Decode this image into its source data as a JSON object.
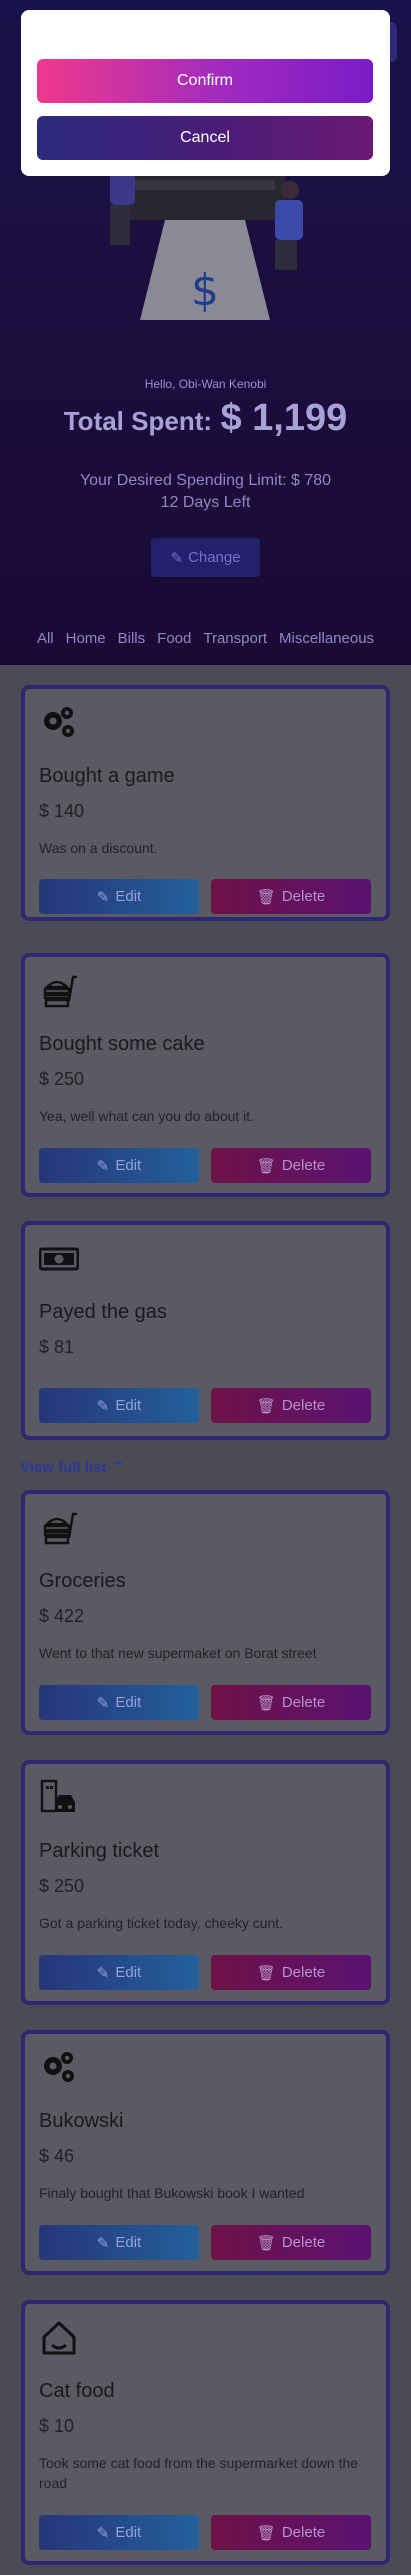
{
  "modal": {
    "confirm_label": "Confirm",
    "cancel_label": "Cancel"
  },
  "header": {
    "greeting": "Hello, Obi-Wan Kenobi",
    "total_label": "Total Spent:",
    "total_amount": "$ 1,199",
    "limit_text": "Your Desired Spending Limit: $ 780",
    "days_left": "12 Days Left",
    "change_label": "Change"
  },
  "filters": [
    "All",
    "Home",
    "Bills",
    "Food",
    "Transport",
    "Miscellaneous"
  ],
  "view_full_label": "View full list",
  "buttons": {
    "edit": "Edit",
    "delete": "Delete"
  },
  "expenses": [
    {
      "icon": "gears-icon",
      "title": "Bought a game",
      "amount": "$ 140",
      "desc": "Was on a discount."
    },
    {
      "icon": "food-icon",
      "title": "Bought some cake",
      "amount": "$ 250",
      "desc": "Yea, well what can you do about it."
    },
    {
      "icon": "money-icon",
      "title": "Payed the gas",
      "amount": "$ 81",
      "desc": ""
    },
    {
      "icon": "food-icon",
      "title": "Groceries",
      "amount": "$ 422",
      "desc": "Went to that new supermaket on Borat street"
    },
    {
      "icon": "car-icon",
      "title": "Parking ticket",
      "amount": "$ 250",
      "desc": "Got a parking ticket today, cheeky cunt."
    },
    {
      "icon": "gears-icon",
      "title": "Bukowski",
      "amount": "$ 46",
      "desc": "Finaly bought that Bukowski book I wanted"
    },
    {
      "icon": "home-icon",
      "title": "Cat food",
      "amount": "$ 10",
      "desc": "Took some cat food from the supermarket down the road"
    }
  ]
}
